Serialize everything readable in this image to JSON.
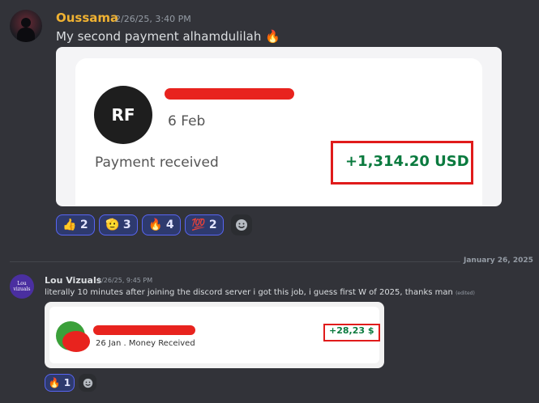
{
  "messages": [
    {
      "author": "Oussama",
      "timestamp": "2/26/25, 3:40 PM",
      "text": "My second payment alhamdulilah 🔥",
      "card": {
        "initials": "RF",
        "date": "6 Feb",
        "label": "Payment received",
        "amount": "+1,314.20 USD"
      },
      "reactions": [
        {
          "emoji": "👍",
          "count": "2"
        },
        {
          "emoji": "🫡",
          "count": "3"
        },
        {
          "emoji": "🔥",
          "count": "4"
        },
        {
          "emoji": "💯",
          "count": "2"
        }
      ]
    },
    {
      "author": "Lou Vizuals",
      "avatar_text": "Lou\nvizuals",
      "timestamp": "1/26/25, 9:45 PM",
      "text": "literally 10 minutes after joining the discord server i got this job, i guess first W of 2025, thanks man",
      "edited": "(edited)",
      "card": {
        "subtitle": "26 Jan . Money Received",
        "amount": "+28,23 $"
      },
      "reactions": [
        {
          "emoji": "🔥",
          "count": "1"
        }
      ]
    }
  ],
  "date_divider": "January 26, 2025",
  "colors": {
    "oussama_name": "#f0b232",
    "lou_name": "#dbdee1",
    "amount_green": "#0a7a3e",
    "highlight_red": "#e01b1b",
    "reaction_bg": "#2e3a6e"
  }
}
